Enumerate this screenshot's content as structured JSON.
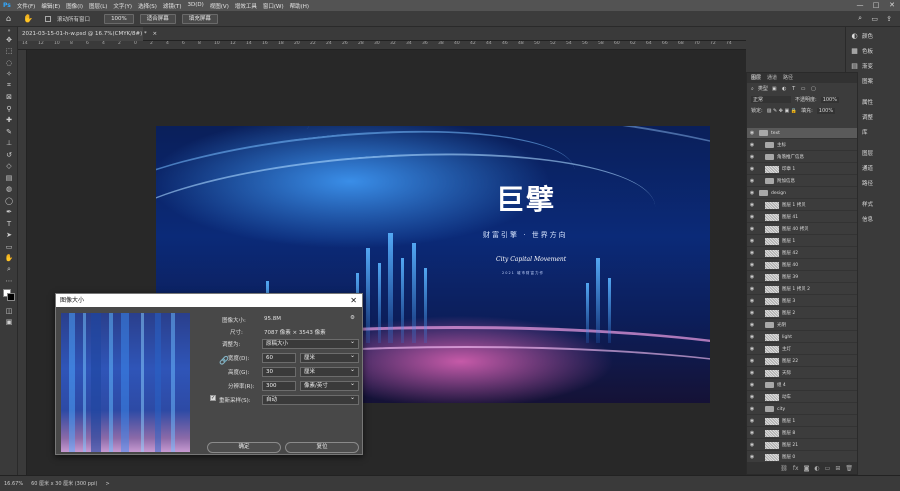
{
  "menubar": {
    "items": [
      "文件(F)",
      "编辑(E)",
      "图像(I)",
      "图层(L)",
      "文字(Y)",
      "选择(S)",
      "滤镜(T)",
      "3D(D)",
      "视图(V)",
      "增效工具",
      "窗口(W)",
      "帮助(H)"
    ],
    "min": "—",
    "max": "□",
    "close": "✕"
  },
  "options": {
    "scroll_all": "滚动所有窗口",
    "zoom": "100%",
    "fit": "适合屏幕",
    "fill": "填充屏幕"
  },
  "document": {
    "tab": "2021-03-15-01-h-w.psd @ 16.7%(CMYK/8#) *",
    "close": "×"
  },
  "ruler": {
    "ticks": [
      "14",
      "12",
      "10",
      "8",
      "6",
      "4",
      "2",
      "0",
      "2",
      "4",
      "6",
      "8",
      "10",
      "12",
      "14",
      "16",
      "18",
      "20",
      "22",
      "24",
      "26",
      "28",
      "30",
      "32",
      "34",
      "36",
      "38",
      "40",
      "42",
      "44",
      "46",
      "48",
      "50",
      "52",
      "54",
      "56",
      "58",
      "60",
      "62",
      "64",
      "66",
      "68",
      "70",
      "72",
      "74"
    ]
  },
  "artwork": {
    "title": "巨擘",
    "subtitle": "财富引擎 · 世界方向",
    "small": "2021 城市财富力作",
    "signature": "City Capital Movement"
  },
  "statusbar": {
    "zoom": "16.67%",
    "docsize": "60 厘米 x 30 厘米 (300 ppi)",
    "arrow": ">"
  },
  "rightdock": {
    "items": [
      {
        "icon": "◐",
        "label": "颜色"
      },
      {
        "icon": "▦",
        "label": "色板"
      },
      {
        "icon": "▤",
        "label": "渐变"
      },
      {
        "icon": "▧",
        "label": "图案"
      },
      {
        "icon": "☰",
        "label": "属性"
      },
      {
        "icon": "◑",
        "label": "调整"
      },
      {
        "icon": "◈",
        "label": "库"
      },
      {
        "icon": "◧",
        "label": "图层"
      },
      {
        "icon": "◎",
        "label": "通道"
      },
      {
        "icon": "✎",
        "label": "路径"
      },
      {
        "icon": "A",
        "label": "样式"
      },
      {
        "icon": "ⓘ",
        "label": "信息"
      }
    ]
  },
  "layers_panel": {
    "tabs": [
      "图层",
      "通道",
      "路径"
    ],
    "kind": "类型",
    "mode": "正常",
    "opacity_label": "不透明度:",
    "opacity": "100%",
    "lock_label": "锁定:",
    "fill_label": "填充:",
    "fill": "100%",
    "rows": [
      {
        "name": "text",
        "type": "folder",
        "indent": 0,
        "sel": true
      },
      {
        "name": "主标",
        "type": "folder",
        "indent": 1
      },
      {
        "name": "角落推广信息",
        "type": "folder",
        "indent": 1
      },
      {
        "name": "印章 1",
        "type": "layer",
        "indent": 1
      },
      {
        "name": "附加信息",
        "type": "folder",
        "indent": 1
      },
      {
        "name": "design",
        "type": "folder",
        "indent": 0
      },
      {
        "name": "图层 1 拷贝",
        "type": "layer",
        "indent": 1
      },
      {
        "name": "图层 41",
        "type": "layer",
        "indent": 1
      },
      {
        "name": "图层 40 拷贝",
        "type": "layer",
        "indent": 1
      },
      {
        "name": "图层 1",
        "type": "layer",
        "indent": 1
      },
      {
        "name": "图层 42",
        "type": "layer",
        "indent": 1
      },
      {
        "name": "图层 40",
        "type": "layer",
        "indent": 1
      },
      {
        "name": "图层 39",
        "type": "layer",
        "indent": 1
      },
      {
        "name": "图层 1 拷贝 2",
        "type": "layer",
        "indent": 1
      },
      {
        "name": "图层 3",
        "type": "layer",
        "indent": 1
      },
      {
        "name": "图层 2",
        "type": "layer",
        "indent": 1
      },
      {
        "name": "光阴",
        "type": "folder",
        "indent": 1
      },
      {
        "name": "light",
        "type": "layer",
        "indent": 1
      },
      {
        "name": "主灯",
        "type": "layer",
        "indent": 1
      },
      {
        "name": "图层 22",
        "type": "layer",
        "indent": 1
      },
      {
        "name": "天际",
        "type": "layer",
        "indent": 1
      },
      {
        "name": "组 4",
        "type": "folder",
        "indent": 1
      },
      {
        "name": "动车",
        "type": "layer",
        "indent": 1
      },
      {
        "name": "city",
        "type": "folder",
        "indent": 1
      },
      {
        "name": "图层 1",
        "type": "layer",
        "indent": 1
      },
      {
        "name": "图层 8",
        "type": "layer",
        "indent": 1
      },
      {
        "name": "图层 21",
        "type": "layer",
        "indent": 1
      },
      {
        "name": "图层 0",
        "type": "layer",
        "indent": 1
      }
    ]
  },
  "dialog": {
    "title": "图像大小",
    "close": "✕",
    "image_size_label": "图像大小:",
    "image_size": "95.8M",
    "dims_label": "尺寸:",
    "dims": "7087 像素 × 3543 像素",
    "fit_label": "调整为:",
    "fit": "原稿大小",
    "width_label": "宽度(D):",
    "width": "60",
    "width_unit": "厘米",
    "height_label": "高度(G):",
    "height": "30",
    "height_unit": "厘米",
    "res_label": "分辨率(R):",
    "res": "300",
    "res_unit": "像素/英寸",
    "resample_label": "重新采样(S):",
    "resample": "自动",
    "ok": "确定",
    "cancel": "复位"
  }
}
